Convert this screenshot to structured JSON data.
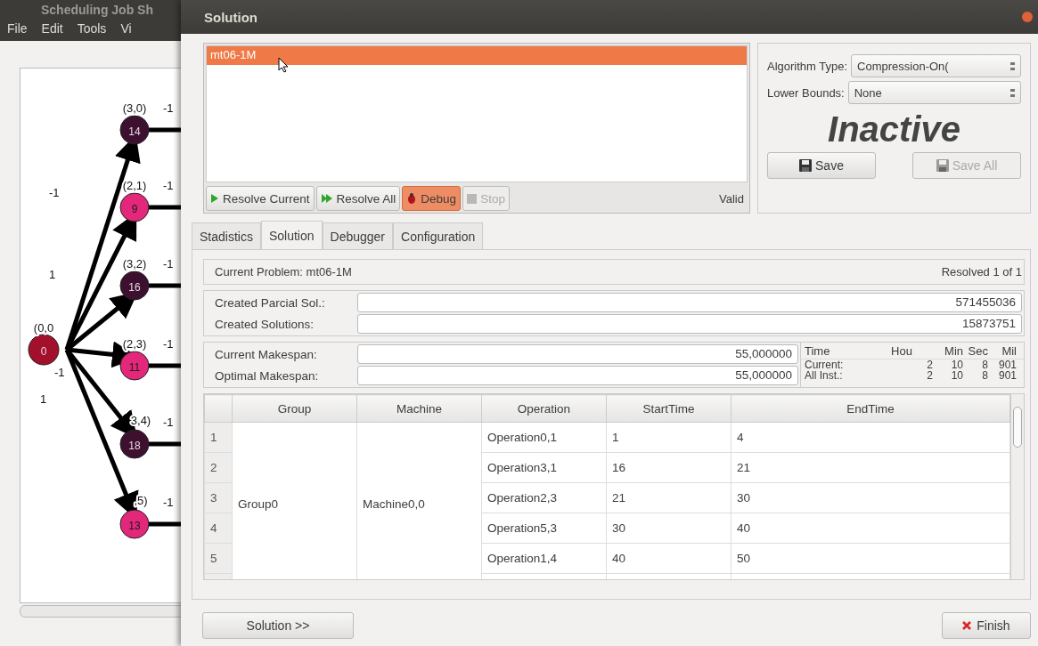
{
  "main_window": {
    "title": "Scheduling Job Sh",
    "menu": [
      "File",
      "Edit",
      "Tools",
      "Vi"
    ],
    "graph": {
      "nodes": [
        {
          "id_label": "0",
          "coord": "(0,0",
          "color": "#a3102c",
          "kind": "root"
        },
        {
          "id_label": "14",
          "coord": "(3,0)",
          "color": "#3e1030",
          "kind": "child",
          "edge_label": "-1"
        },
        {
          "id_label": "9",
          "coord": "(2,1)",
          "color": "#e3287c",
          "kind": "child",
          "edge_label": "-1"
        },
        {
          "id_label": "16",
          "coord": "(3,2)",
          "color": "#3e1030",
          "kind": "child",
          "edge_label": "-1"
        },
        {
          "id_label": "11",
          "coord": "(2,3)",
          "color": "#e3287c",
          "kind": "child",
          "edge_label": "-1"
        },
        {
          "id_label": "18",
          "coord": "3,4)",
          "color": "#3e1030",
          "kind": "child",
          "edge_label": "-1"
        },
        {
          "id_label": "13",
          "coord": ",5)",
          "color": "#e3287c",
          "kind": "child",
          "edge_label": "-1"
        }
      ],
      "root_edge_labels": [
        "-1",
        "1",
        "-1",
        "1"
      ]
    }
  },
  "dialog": {
    "title": "Solution",
    "problems": [
      {
        "label": "mt06-1M",
        "selected": true
      }
    ],
    "actions": [
      {
        "label": "Resolve Current",
        "kind": "play",
        "disabled": false,
        "on": false
      },
      {
        "label": "Resolve All",
        "kind": "play-double",
        "disabled": false,
        "on": false
      },
      {
        "label": "Debug",
        "kind": "bug",
        "disabled": false,
        "on": true
      },
      {
        "label": "Stop",
        "kind": "stop",
        "disabled": true,
        "on": false
      }
    ],
    "list_status": "Valid",
    "algorithm_type": {
      "label": "Algorithm Type:",
      "value": "Compression-On("
    },
    "lower_bounds": {
      "label": "Lower Bounds:",
      "value": "None"
    },
    "status": "Inactive",
    "save_buttons": [
      {
        "label": "Save",
        "disabled": false
      },
      {
        "label": "Save All",
        "disabled": true
      }
    ],
    "tabs": [
      {
        "label": "Stadistics",
        "selected": false
      },
      {
        "label": "Solution",
        "selected": true
      },
      {
        "label": "Debugger",
        "selected": false
      },
      {
        "label": "Configuration",
        "selected": false
      }
    ],
    "current_problem": "Current Problem: mt06-1M",
    "resolved": "Resolved 1 of 1",
    "counters": [
      {
        "label": "Created Parcial Sol.:",
        "value": "571455036"
      },
      {
        "label": "Created Solutions:",
        "value": "15873751"
      }
    ],
    "makespans": [
      {
        "label": "Current Makespan:",
        "value": "55,000000"
      },
      {
        "label": "Optimal Makespan:",
        "value": "55,000000"
      }
    ],
    "time": {
      "columns": [
        "Time",
        "Hou",
        "Min",
        "Sec",
        "Mil"
      ],
      "rows": [
        [
          "Current:",
          "2",
          "10",
          "8",
          "901"
        ],
        [
          "All Inst.:",
          "2",
          "10",
          "8",
          "901"
        ]
      ]
    },
    "table": {
      "columns": [
        "Group",
        "Machine",
        "Operation",
        "StartTime",
        "EndTime"
      ],
      "group": "Group0",
      "machine": "Machine0,0",
      "rows": [
        {
          "number": "1",
          "operation": "Operation0,1",
          "start": "1",
          "end": "4"
        },
        {
          "number": "2",
          "operation": "Operation3,1",
          "start": "16",
          "end": "21"
        },
        {
          "number": "3",
          "operation": "Operation2,3",
          "start": "21",
          "end": "30"
        },
        {
          "number": "4",
          "operation": "Operation5,3",
          "start": "30",
          "end": "40"
        },
        {
          "number": "5",
          "operation": "Operation1,4",
          "start": "40",
          "end": "50"
        }
      ]
    },
    "footer_left": "Solution >>",
    "footer_right": "Finish"
  }
}
